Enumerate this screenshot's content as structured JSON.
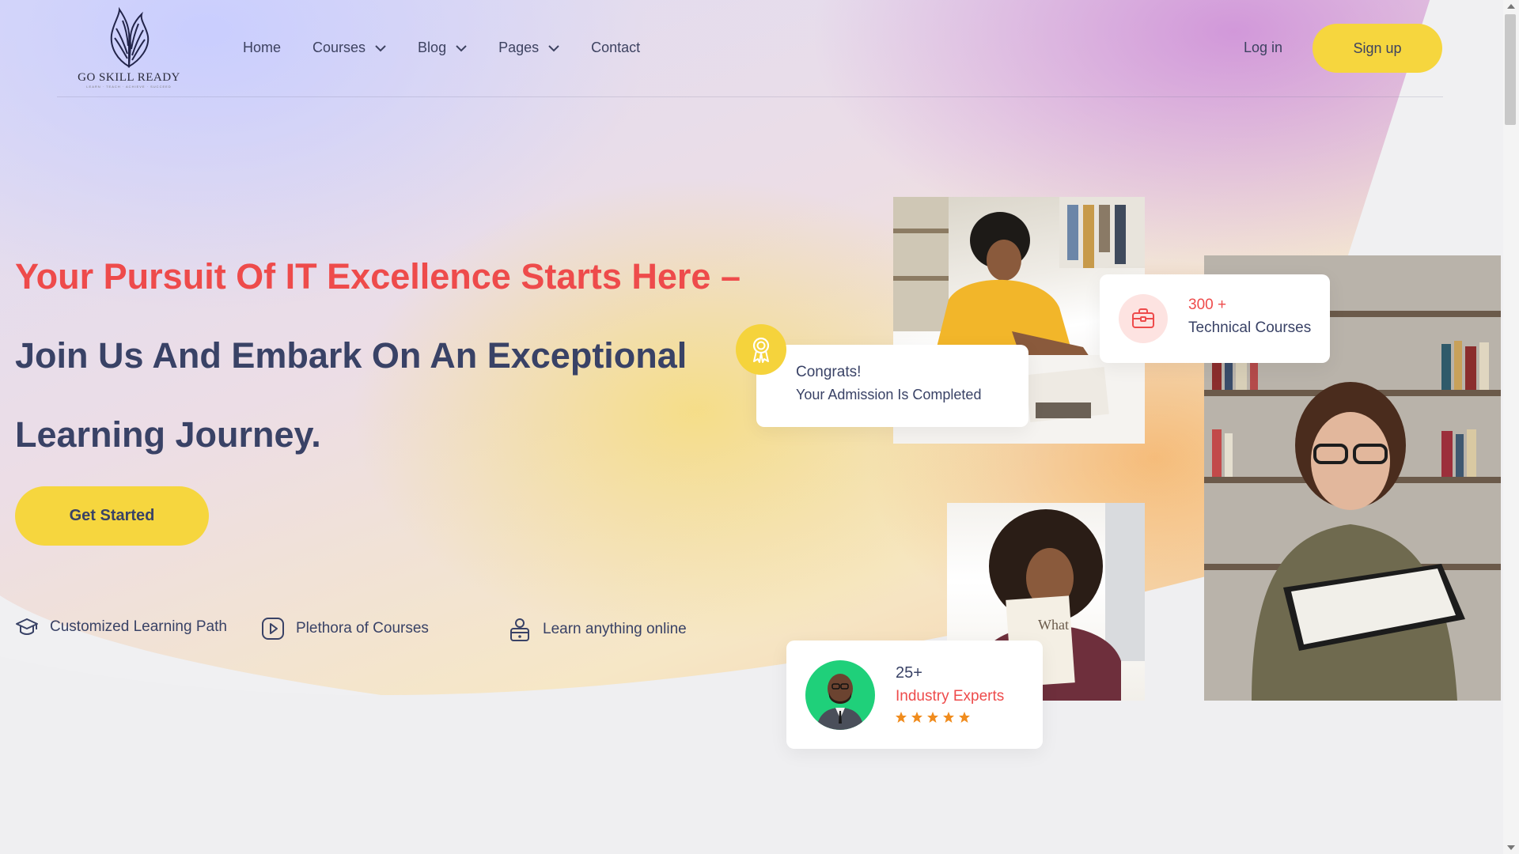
{
  "brand": {
    "name": "GO SKILL READY",
    "tagline": "LEARN · TEACH · ACHIEVE · SUCCEED"
  },
  "nav": {
    "items": [
      {
        "label": "Home",
        "dropdown": false
      },
      {
        "label": "Courses",
        "dropdown": true
      },
      {
        "label": "Blog",
        "dropdown": true
      },
      {
        "label": "Pages",
        "dropdown": true
      },
      {
        "label": "Contact",
        "dropdown": false
      }
    ],
    "login_label": "Log in",
    "signup_label": "Sign up"
  },
  "hero": {
    "line1": "Your Pursuit Of IT Excellence Starts Here –",
    "line2": "Join Us And Embark On An Exceptional",
    "line3": "Learning Journey.",
    "cta_label": "Get Started"
  },
  "features": [
    {
      "icon": "graduation-cap-icon",
      "label": "Customized Learning Path"
    },
    {
      "icon": "play-icon",
      "label": "Plethora of Courses"
    },
    {
      "icon": "online-lock-icon",
      "label": "Learn anything online"
    }
  ],
  "cards": {
    "admission": {
      "title": "Congrats!",
      "text": "Your Admission Is Completed",
      "icon": "award-icon"
    },
    "courses": {
      "count": "300 +",
      "label": "Technical Courses",
      "icon": "briefcase-icon"
    },
    "experts": {
      "count": "25+",
      "label": "Industry Experts",
      "rating": 5
    }
  },
  "colors": {
    "accent_yellow": "#f6d63e",
    "accent_red": "#ee4b4b",
    "text_navy": "#394266",
    "expert_avatar_bg": "#1fd07a"
  }
}
